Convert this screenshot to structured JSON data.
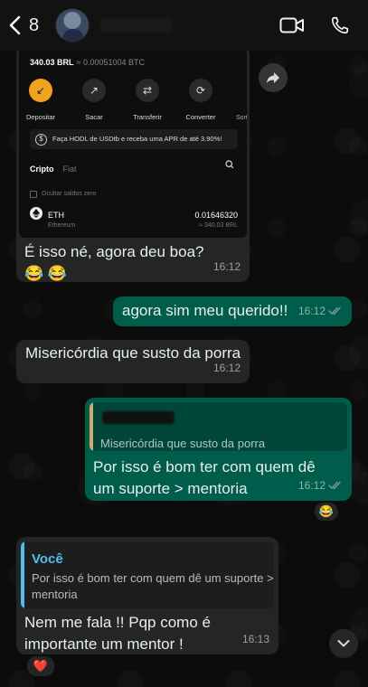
{
  "header": {
    "back_count": "8",
    "icons": [
      "back-chevron-icon",
      "video-call-icon",
      "phone-icon"
    ]
  },
  "shared_screenshot": {
    "balance": "340.03 BRL",
    "balance_btc": "≈ 0.00051004 BTC",
    "actions": [
      {
        "label": "Depositar",
        "icon": "download-arrow-icon"
      },
      {
        "label": "Sacar",
        "icon": "upload-arrow-icon"
      },
      {
        "label": "Transferir",
        "icon": "transfer-icon"
      },
      {
        "label": "Converter",
        "icon": "convert-icon"
      }
    ],
    "actions_more": "Sort",
    "promo": "Faça HODL de USDtb e receba uma APR de até 3.90%!",
    "tabs": [
      "Cripto",
      "Fiat"
    ],
    "hide_zero": "Ocultar saldos zero",
    "asset": {
      "symbol": "ETH",
      "name": "Ethereum",
      "amount": "0.01646320",
      "brl": "≈ 340.03 BRL"
    }
  },
  "messages": {
    "m1": {
      "text": "É isso né, agora deu boa? 😂 😂",
      "time": "16:12"
    },
    "m2": {
      "text": "agora sim meu querido!!",
      "time": "16:12"
    },
    "m3": {
      "text": "Misericórdia que susto da porra",
      "time": "16:12"
    },
    "m4": {
      "quote_text": "Misericórdia que susto da porra",
      "text": "Por isso é bom ter com quem dê um suporte > mentoria",
      "time": "16:12",
      "reaction": "😂"
    },
    "m5": {
      "quote_author": "Você",
      "quote_text": "Por isso é bom ter com quem dê um suporte > mentoria",
      "text": "Nem me fala !! Pqp como é importante um mentor !",
      "time": "16:13",
      "reaction": "❤️"
    }
  },
  "colors": {
    "incoming_bubble": "#242626",
    "outgoing_bubble": "#005c4b",
    "quote_author": "#53bdeb",
    "read_ticks": "#8696a0"
  }
}
